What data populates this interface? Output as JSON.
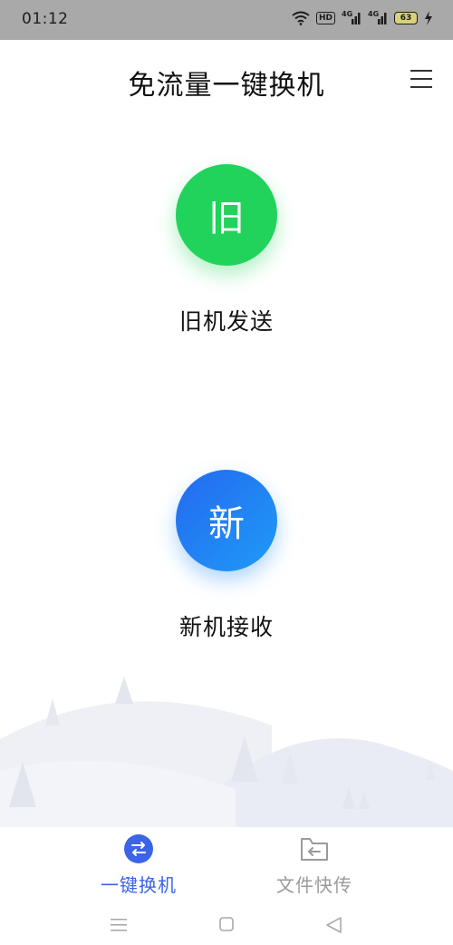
{
  "status_bar": {
    "time": "01:12",
    "hd": "HD",
    "signal1": "4G",
    "signal2": "4G",
    "battery": "63"
  },
  "header": {
    "title": "免流量一键换机",
    "menu_icon": "hamburger-menu-icon"
  },
  "actions": {
    "old_phone": {
      "icon_text": "旧",
      "label": "旧机发送",
      "color": "#21d35b"
    },
    "new_phone": {
      "icon_text": "新",
      "label": "新机接收",
      "color": "#1f8cf6"
    }
  },
  "bottom_nav": {
    "items": [
      {
        "label": "一键换机",
        "icon": "swap-arrows-icon",
        "active": true,
        "color": "#3b64e6"
      },
      {
        "label": "文件快传",
        "icon": "folder-transfer-icon",
        "active": false,
        "color": "#9a9a9a"
      }
    ]
  },
  "system_nav": {
    "menu_icon": "recent-apps-icon",
    "home_icon": "home-icon",
    "back_icon": "back-icon"
  }
}
